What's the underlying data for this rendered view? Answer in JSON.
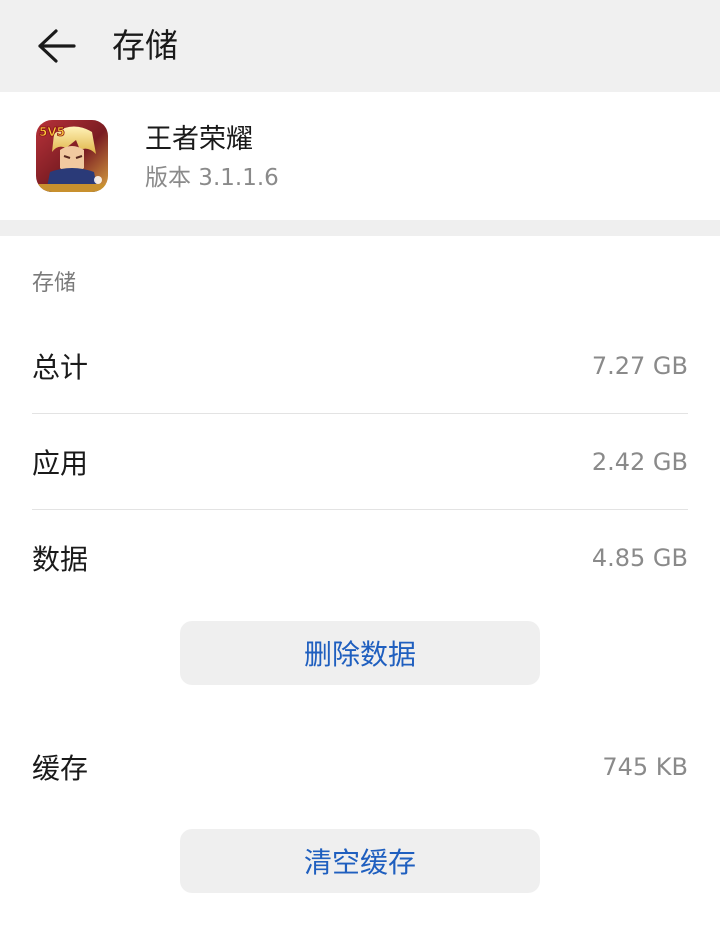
{
  "header": {
    "back_icon": "arrow-left-icon",
    "title": "存储"
  },
  "app": {
    "icon": "app-icon",
    "icon_badge": "5V5",
    "name": "王者荣耀",
    "version": "版本 3.1.1.6"
  },
  "storage": {
    "section_label": "存储",
    "rows": [
      {
        "label": "总计",
        "value": "7.27 GB"
      },
      {
        "label": "应用",
        "value": "2.42 GB"
      },
      {
        "label": "数据",
        "value": "4.85 GB"
      }
    ],
    "delete_data_button": "删除数据",
    "cache": {
      "label": "缓存",
      "value": "745 KB"
    },
    "clear_cache_button": "清空缓存"
  },
  "colors": {
    "accent": "#1f5fbf",
    "topbar_bg": "#f0f0f0",
    "button_bg": "#efefef",
    "secondary_text": "#8a8a8a"
  }
}
